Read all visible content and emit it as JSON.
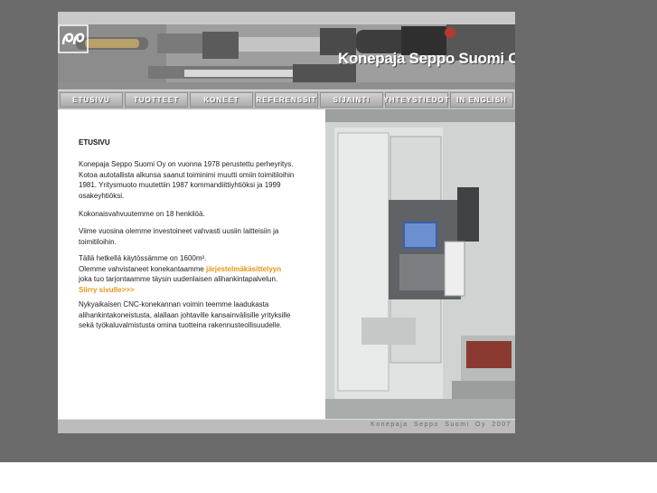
{
  "brand": {
    "company_name": "Konepaja Seppo Suomi Oy"
  },
  "nav": {
    "items": [
      {
        "label": "ETUSIVU"
      },
      {
        "label": "TUOTTEET"
      },
      {
        "label": "KONEET"
      },
      {
        "label": "REFERENSSIT"
      },
      {
        "label": "SIJAINTI"
      },
      {
        "label": "YHTEYSTIEDOT"
      },
      {
        "label": "IN ENGLISH"
      }
    ]
  },
  "content": {
    "heading": "ETUSIVU",
    "p1": "Konepaja Seppo Suomi Oy on vuonna 1978 perustettu perheyritys. Kotoa autotallista alkunsa saanut toiminimi muutti omiin toimitiloihin 1981. Yritysmuoto muutettiin 1987 kommandiittiyhtiöksi ja 1999 osakeyhtiöksi.",
    "p2": "Kokonaisvahvuutemme on 18 henkilöä.",
    "p3": "Viime vuosina olemme investoineet vahvasti uusiin laitteisiin ja toimitiloihin.",
    "p4_line1": "Tällä hetkellä käytössämme on 1600m².",
    "p4_line2_pre": "Olemme vahvistaneet konekantaamme ",
    "p4_link": "järjestelmäkäsittelyyn",
    "p4_line2_post": "joka tuo tarjontaamme täysin uudenlaisen alihankintapalvelun.",
    "p4_more": "Siirry sivulle>>>",
    "p5": "Nykyaikaisen CNC-konekannan voimin teemme laadukasta alihankintakoneistusta, alallaan johtaville kansainvälisille yrityksille sekä työkaluvalmistusta omina tuotteina rakennusteollisuudelle."
  },
  "footer": {
    "text": "Konepaja Seppo Suomi Oy 2007"
  },
  "colors": {
    "accent": "#e89418",
    "page_bg": "#6b6b6b"
  }
}
